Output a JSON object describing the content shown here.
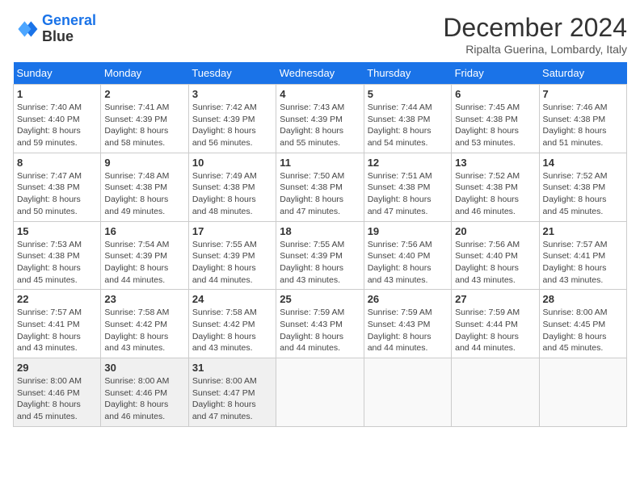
{
  "header": {
    "logo_line1": "General",
    "logo_line2": "Blue",
    "month_title": "December 2024",
    "location": "Ripalta Guerina, Lombardy, Italy"
  },
  "days_of_week": [
    "Sunday",
    "Monday",
    "Tuesday",
    "Wednesday",
    "Thursday",
    "Friday",
    "Saturday"
  ],
  "weeks": [
    [
      {
        "day": "1",
        "sunrise": "7:40 AM",
        "sunset": "4:40 PM",
        "daylight": "8 hours and 59 minutes."
      },
      {
        "day": "2",
        "sunrise": "7:41 AM",
        "sunset": "4:39 PM",
        "daylight": "8 hours and 58 minutes."
      },
      {
        "day": "3",
        "sunrise": "7:42 AM",
        "sunset": "4:39 PM",
        "daylight": "8 hours and 56 minutes."
      },
      {
        "day": "4",
        "sunrise": "7:43 AM",
        "sunset": "4:39 PM",
        "daylight": "8 hours and 55 minutes."
      },
      {
        "day": "5",
        "sunrise": "7:44 AM",
        "sunset": "4:38 PM",
        "daylight": "8 hours and 54 minutes."
      },
      {
        "day": "6",
        "sunrise": "7:45 AM",
        "sunset": "4:38 PM",
        "daylight": "8 hours and 53 minutes."
      },
      {
        "day": "7",
        "sunrise": "7:46 AM",
        "sunset": "4:38 PM",
        "daylight": "8 hours and 51 minutes."
      }
    ],
    [
      {
        "day": "8",
        "sunrise": "7:47 AM",
        "sunset": "4:38 PM",
        "daylight": "8 hours and 50 minutes."
      },
      {
        "day": "9",
        "sunrise": "7:48 AM",
        "sunset": "4:38 PM",
        "daylight": "8 hours and 49 minutes."
      },
      {
        "day": "10",
        "sunrise": "7:49 AM",
        "sunset": "4:38 PM",
        "daylight": "8 hours and 48 minutes."
      },
      {
        "day": "11",
        "sunrise": "7:50 AM",
        "sunset": "4:38 PM",
        "daylight": "8 hours and 47 minutes."
      },
      {
        "day": "12",
        "sunrise": "7:51 AM",
        "sunset": "4:38 PM",
        "daylight": "8 hours and 47 minutes."
      },
      {
        "day": "13",
        "sunrise": "7:52 AM",
        "sunset": "4:38 PM",
        "daylight": "8 hours and 46 minutes."
      },
      {
        "day": "14",
        "sunrise": "7:52 AM",
        "sunset": "4:38 PM",
        "daylight": "8 hours and 45 minutes."
      }
    ],
    [
      {
        "day": "15",
        "sunrise": "7:53 AM",
        "sunset": "4:38 PM",
        "daylight": "8 hours and 45 minutes."
      },
      {
        "day": "16",
        "sunrise": "7:54 AM",
        "sunset": "4:39 PM",
        "daylight": "8 hours and 44 minutes."
      },
      {
        "day": "17",
        "sunrise": "7:55 AM",
        "sunset": "4:39 PM",
        "daylight": "8 hours and 44 minutes."
      },
      {
        "day": "18",
        "sunrise": "7:55 AM",
        "sunset": "4:39 PM",
        "daylight": "8 hours and 43 minutes."
      },
      {
        "day": "19",
        "sunrise": "7:56 AM",
        "sunset": "4:40 PM",
        "daylight": "8 hours and 43 minutes."
      },
      {
        "day": "20",
        "sunrise": "7:56 AM",
        "sunset": "4:40 PM",
        "daylight": "8 hours and 43 minutes."
      },
      {
        "day": "21",
        "sunrise": "7:57 AM",
        "sunset": "4:41 PM",
        "daylight": "8 hours and 43 minutes."
      }
    ],
    [
      {
        "day": "22",
        "sunrise": "7:57 AM",
        "sunset": "4:41 PM",
        "daylight": "8 hours and 43 minutes."
      },
      {
        "day": "23",
        "sunrise": "7:58 AM",
        "sunset": "4:42 PM",
        "daylight": "8 hours and 43 minutes."
      },
      {
        "day": "24",
        "sunrise": "7:58 AM",
        "sunset": "4:42 PM",
        "daylight": "8 hours and 43 minutes."
      },
      {
        "day": "25",
        "sunrise": "7:59 AM",
        "sunset": "4:43 PM",
        "daylight": "8 hours and 44 minutes."
      },
      {
        "day": "26",
        "sunrise": "7:59 AM",
        "sunset": "4:43 PM",
        "daylight": "8 hours and 44 minutes."
      },
      {
        "day": "27",
        "sunrise": "7:59 AM",
        "sunset": "4:44 PM",
        "daylight": "8 hours and 44 minutes."
      },
      {
        "day": "28",
        "sunrise": "8:00 AM",
        "sunset": "4:45 PM",
        "daylight": "8 hours and 45 minutes."
      }
    ],
    [
      {
        "day": "29",
        "sunrise": "8:00 AM",
        "sunset": "4:46 PM",
        "daylight": "8 hours and 45 minutes."
      },
      {
        "day": "30",
        "sunrise": "8:00 AM",
        "sunset": "4:46 PM",
        "daylight": "8 hours and 46 minutes."
      },
      {
        "day": "31",
        "sunrise": "8:00 AM",
        "sunset": "4:47 PM",
        "daylight": "8 hours and 47 minutes."
      },
      null,
      null,
      null,
      null
    ]
  ]
}
